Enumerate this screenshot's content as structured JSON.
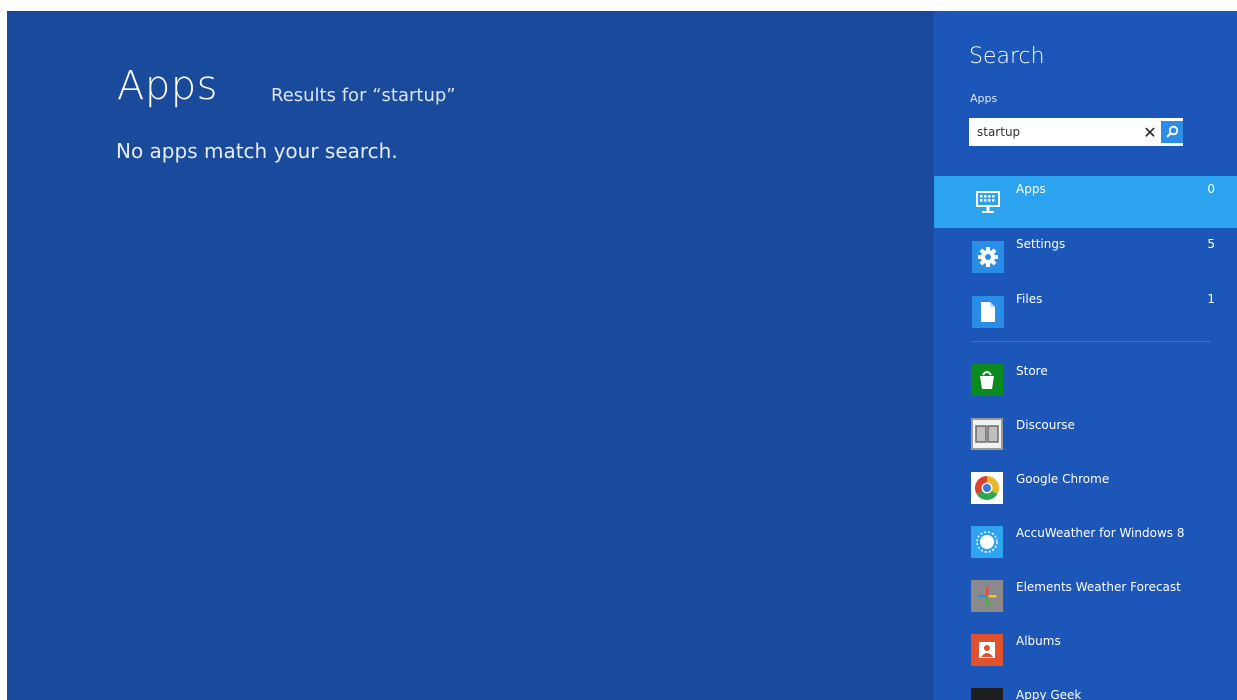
{
  "results": {
    "title": "Apps",
    "results_for": "Results for “startup”",
    "empty_message": "No apps match your search."
  },
  "search": {
    "title": "Search",
    "scope": "Apps",
    "query": "startup",
    "clear_glyph": "✕"
  },
  "categories": [
    {
      "label": "Apps",
      "count": "0",
      "icon": "apps-icon",
      "selected": true
    },
    {
      "label": "Settings",
      "count": "5",
      "icon": "gear-icon",
      "selected": false
    },
    {
      "label": "Files",
      "count": "1",
      "icon": "file-icon",
      "selected": false
    }
  ],
  "apps": [
    {
      "label": "Store",
      "icon": "store-icon"
    },
    {
      "label": "Discourse",
      "icon": "discourse-icon"
    },
    {
      "label": "Google Chrome",
      "icon": "chrome-icon"
    },
    {
      "label": "AccuWeather for Windows 8",
      "icon": "accuweather-icon"
    },
    {
      "label": "Elements Weather Forecast",
      "icon": "elements-weather-icon"
    },
    {
      "label": "Albums",
      "icon": "albums-icon"
    },
    {
      "label": "Appy Geek",
      "icon": "appy-geek-icon"
    }
  ],
  "colors": {
    "background": "#1a4a9c",
    "charm_background": "#1c56b8",
    "selected_item": "#2ba3ef",
    "search_button": "#2d8ce6"
  }
}
